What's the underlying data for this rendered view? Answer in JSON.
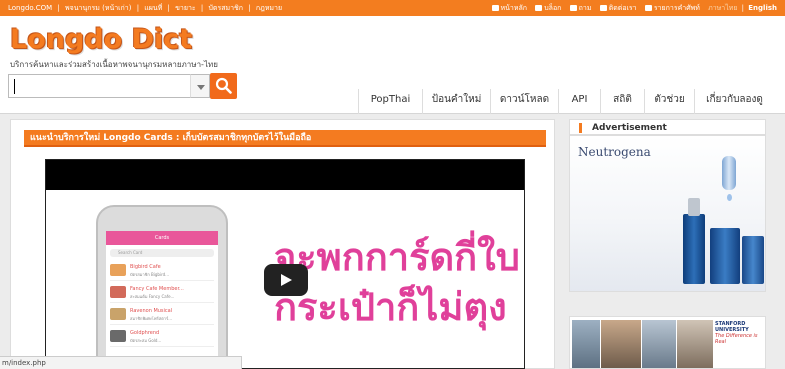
{
  "topbar": {
    "left_links": [
      "Longdo.COM",
      "|",
      "พจนานุกรม (หน้าเก่า)",
      "|",
      "แผนที่",
      "|",
      "ขายาะ",
      "|",
      "บัตรสมาชิก",
      "|",
      "กฎหมาย"
    ],
    "right_links": [
      "หน้าหลัก",
      "บล็อก",
      "ถาม",
      "ติดต่อเรา",
      "รายการคำศัพท์"
    ],
    "lang_inactive": "ภาษาไทย",
    "lang_separator": "|",
    "lang_active": "English"
  },
  "header": {
    "logo": "Longdo Dict",
    "tagline": "บริการค้นหาและร่วมสร้างเนื้อหาพจนานุกรมหลายภาษา-ไทย",
    "search": {
      "value": ""
    },
    "nav": [
      "PopThai",
      "ป้อนคำใหม่",
      "ดาวน์โหลด",
      "API",
      "สถิติ",
      "ตัวช่วย",
      "เกี่ยวกับลองดู"
    ]
  },
  "main": {
    "banner": "แนะนำบริการใหม่ Longdo Cards : เก็บบัตรสมาชิกทุกบัตรไว้ในมือถือ",
    "video": {
      "headline_line1": "จะพกการ์ดกี่ใบ",
      "headline_line2": "กระเป๋าก็ไม่ตุง",
      "phone": {
        "screen_title": "Cards",
        "search_placeholder": "Search Card",
        "rows": [
          {
            "title": "Bigbird Cafe",
            "sub": "บัตรสมาชิก Bigbird..."
          },
          {
            "title": "Fancy Cafe Member...",
            "sub": "สะสมแต้ม Fancy Cafe..."
          },
          {
            "title": "Ravenon Musical",
            "sub": "สมาชิกพิเศษโฟร์สตาร์..."
          },
          {
            "title": "Goldphrend",
            "sub": "บัตรสะสม Gold..."
          }
        ]
      }
    }
  },
  "statusbar": {
    "text": "m/index.php"
  },
  "sidebar": {
    "ad_heading": "Advertisement",
    "ad1_brand": "Neutrogena",
    "ad2_logo_line1": "STANFORD",
    "ad2_logo_line2": "UNIVERSITY",
    "ad2_logo_tag": "The Difference is Real"
  },
  "colors": {
    "accent": "#f37d1f",
    "pink": "#e0409a",
    "navy": "#1d3a78"
  }
}
